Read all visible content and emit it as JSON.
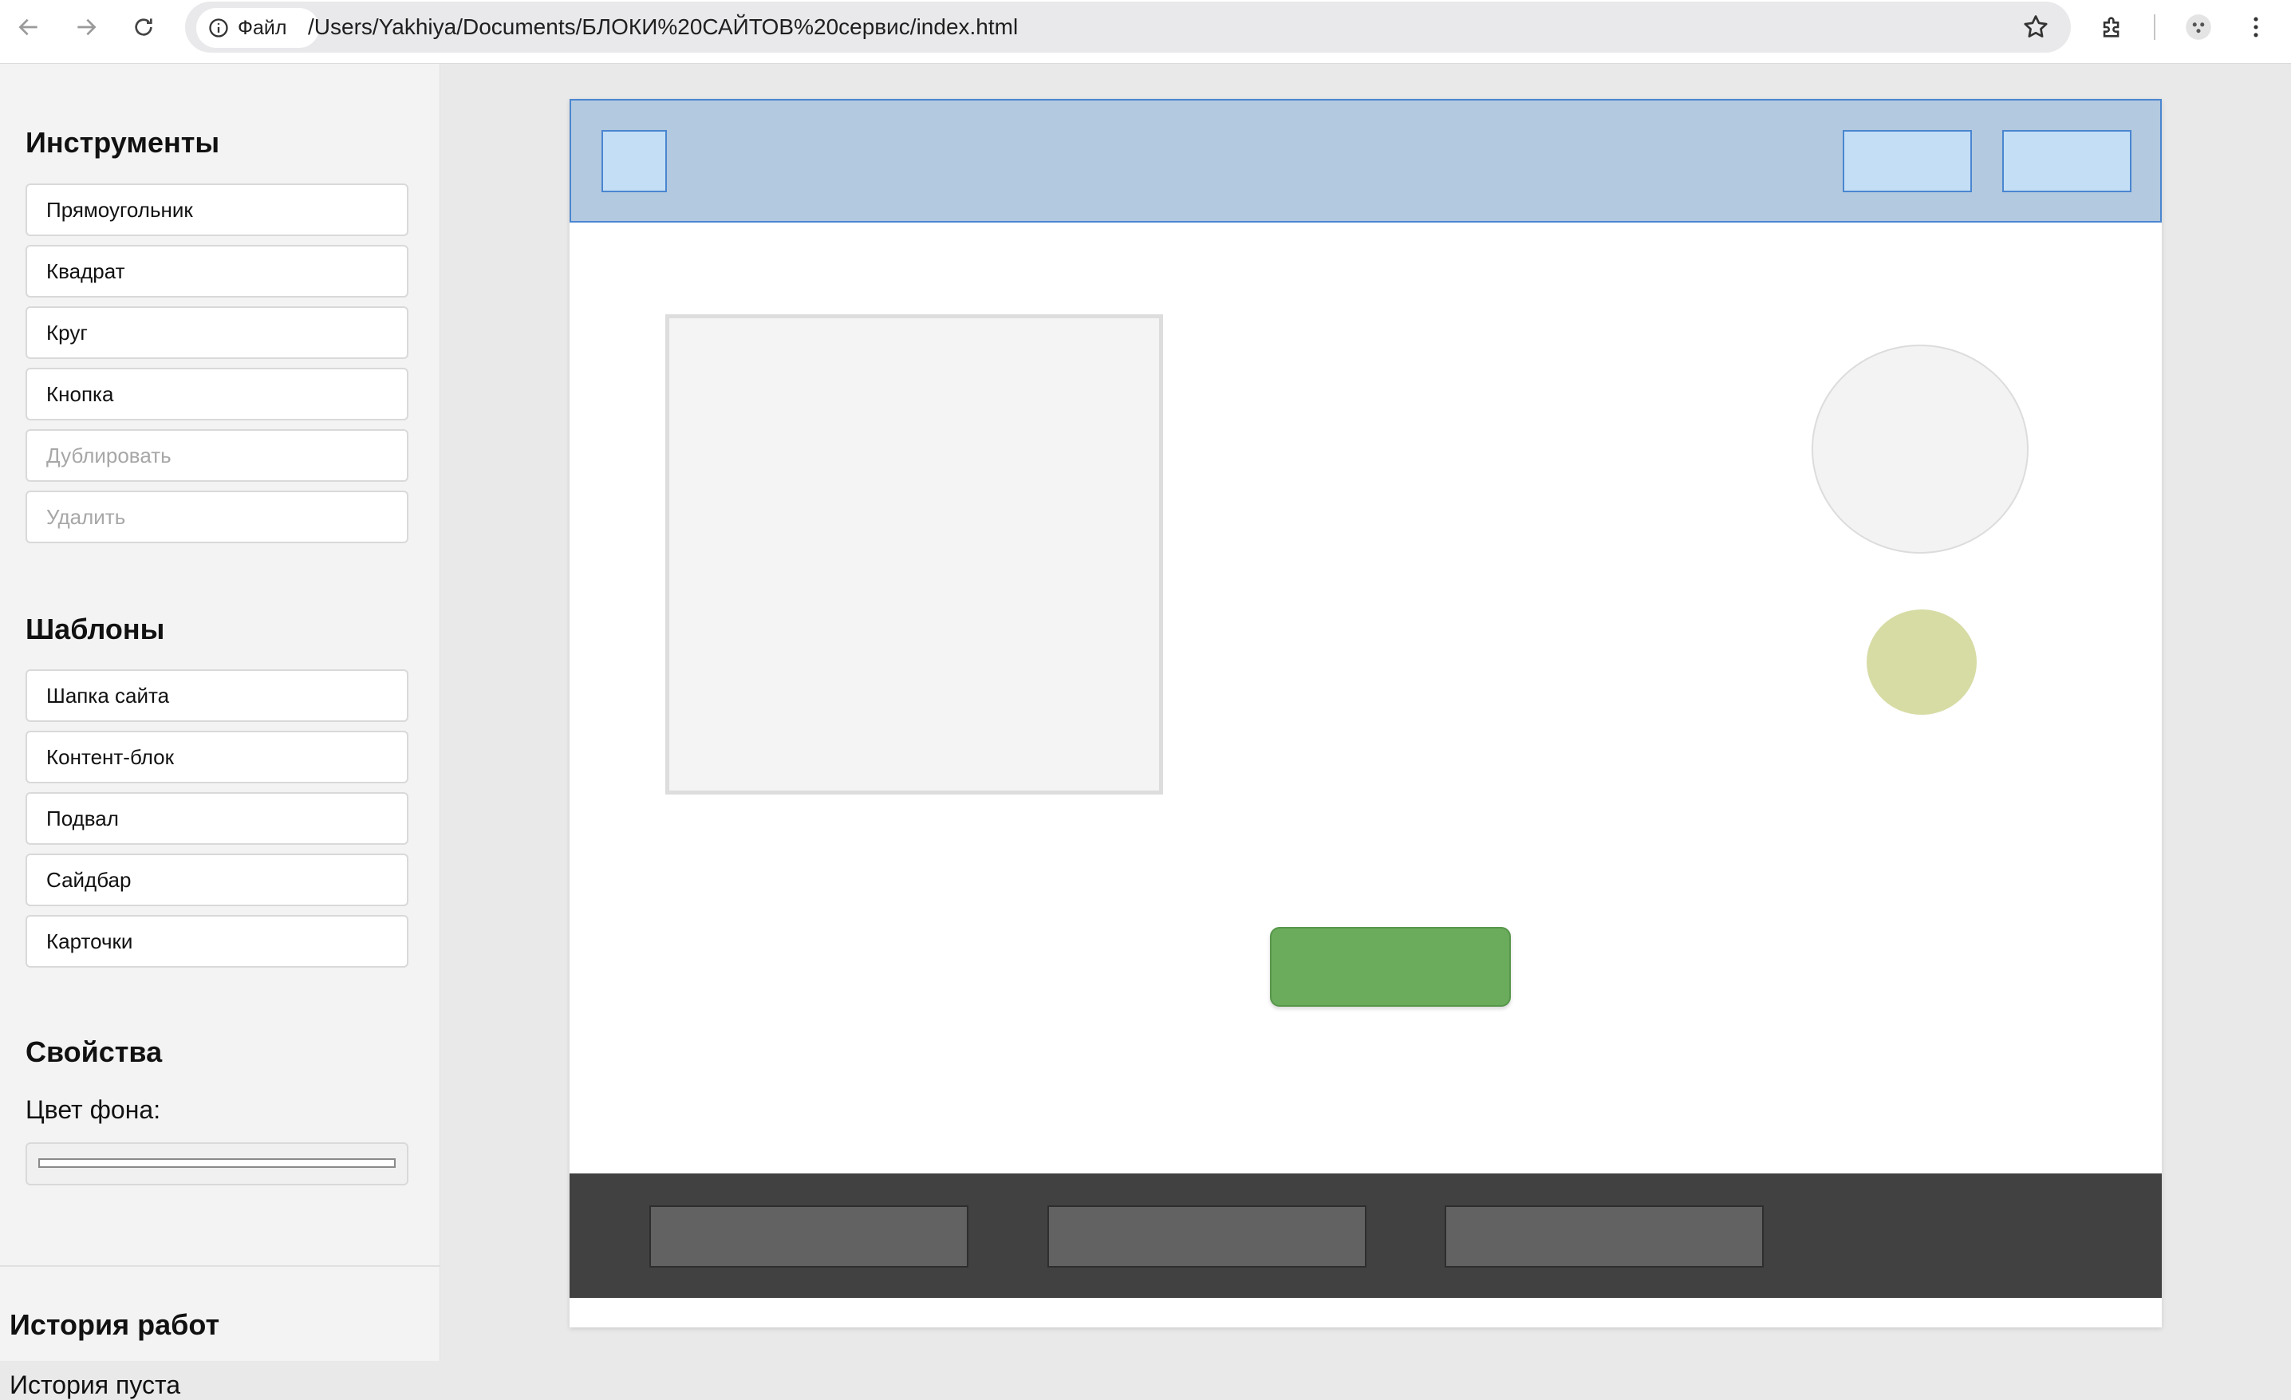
{
  "browser": {
    "site_chip_label": "Файл",
    "url": "/Users/Yakhiya/Documents/БЛОКИ%20САЙТОВ%20сервис/index.html",
    "icons": [
      "back-arrow-icon",
      "forward-arrow-icon",
      "reload-icon",
      "info-icon",
      "star-icon",
      "extensions-icon",
      "profile-icon",
      "more-vert-icon"
    ]
  },
  "panel": {
    "tools_title": "Инструменты",
    "tools": [
      {
        "label": "Прямоугольник",
        "disabled": false
      },
      {
        "label": "Квадрат",
        "disabled": false
      },
      {
        "label": "Круг",
        "disabled": false
      },
      {
        "label": "Кнопка",
        "disabled": false
      },
      {
        "label": "Дублировать",
        "disabled": true
      },
      {
        "label": "Удалить",
        "disabled": true
      }
    ],
    "templates_title": "Шаблоны",
    "templates": [
      {
        "label": "Шапка сайта"
      },
      {
        "label": "Контент-блок"
      },
      {
        "label": "Подвал"
      },
      {
        "label": "Сайдбар"
      },
      {
        "label": "Карточки"
      }
    ],
    "properties_title": "Свойства",
    "bg_color_label": "Цвет фона:",
    "bg_color_value": "#ffffff"
  },
  "history": {
    "title": "История работ",
    "empty_text": "История пуста"
  },
  "colors": {
    "header_fill": "#b3c9df",
    "header_border": "#4a86d0",
    "header_item_fill": "#c4def6",
    "button_green": "#6aab5c",
    "footer_fill": "#414141",
    "footer_item_fill": "#626262",
    "small_circle": "#d7dca5"
  }
}
